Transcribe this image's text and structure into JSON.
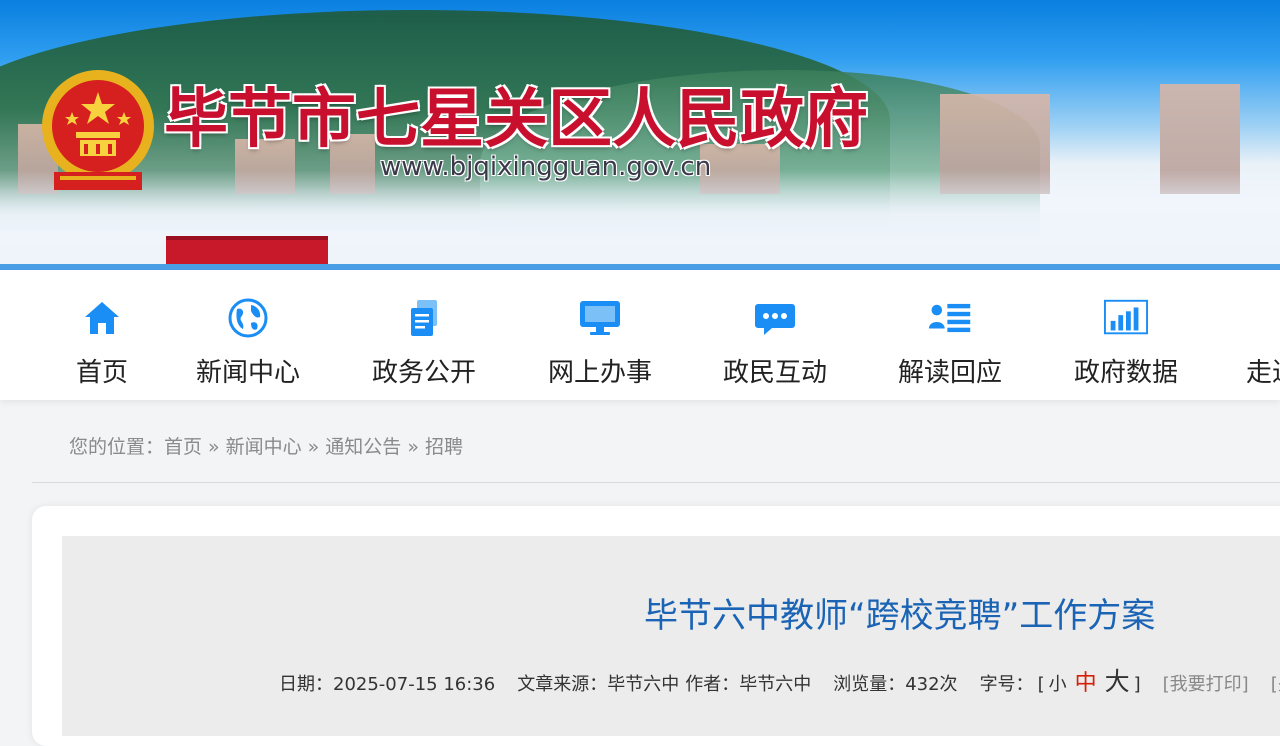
{
  "header": {
    "site_title": "毕节市七星关区人民政府",
    "site_url": "www.bjqixingguan.gov.cn"
  },
  "colors": {
    "accent_red": "#c8102e",
    "nav_icon_blue": "#1a8ef5",
    "title_blue": "#1a63b5",
    "active_size_red": "#d81e06"
  },
  "nav": {
    "items": [
      {
        "label": "首页",
        "icon": "home-icon"
      },
      {
        "label": "新闻中心",
        "icon": "globe-icon"
      },
      {
        "label": "政务公开",
        "icon": "document-icon"
      },
      {
        "label": "网上办事",
        "icon": "monitor-icon"
      },
      {
        "label": "政民互动",
        "icon": "chat-bubble-icon"
      },
      {
        "label": "解读回应",
        "icon": "user-list-icon"
      },
      {
        "label": "政府数据",
        "icon": "bar-chart-icon"
      },
      {
        "label": "走进",
        "icon": ""
      }
    ]
  },
  "breadcrumb": {
    "prefix": "您的位置：",
    "items": [
      "首页",
      "新闻中心",
      "通知公告",
      "招聘"
    ],
    "separator": "»"
  },
  "article": {
    "title": "毕节六中教师“跨校竞聘”工作方案",
    "date_label": "日期：",
    "date": "2025-07-15 16:36",
    "source_label": "文章来源：",
    "source": "毕节六中",
    "author_label": "作者：",
    "author": "毕节六中",
    "views_label": "浏览量：",
    "views": "432次",
    "font_size_label": "字号：",
    "bracket_open": "[",
    "bracket_close": "]",
    "size_small": "小",
    "size_medium": "中",
    "size_large": "大",
    "print": "[我要打印]",
    "close": "[关"
  }
}
